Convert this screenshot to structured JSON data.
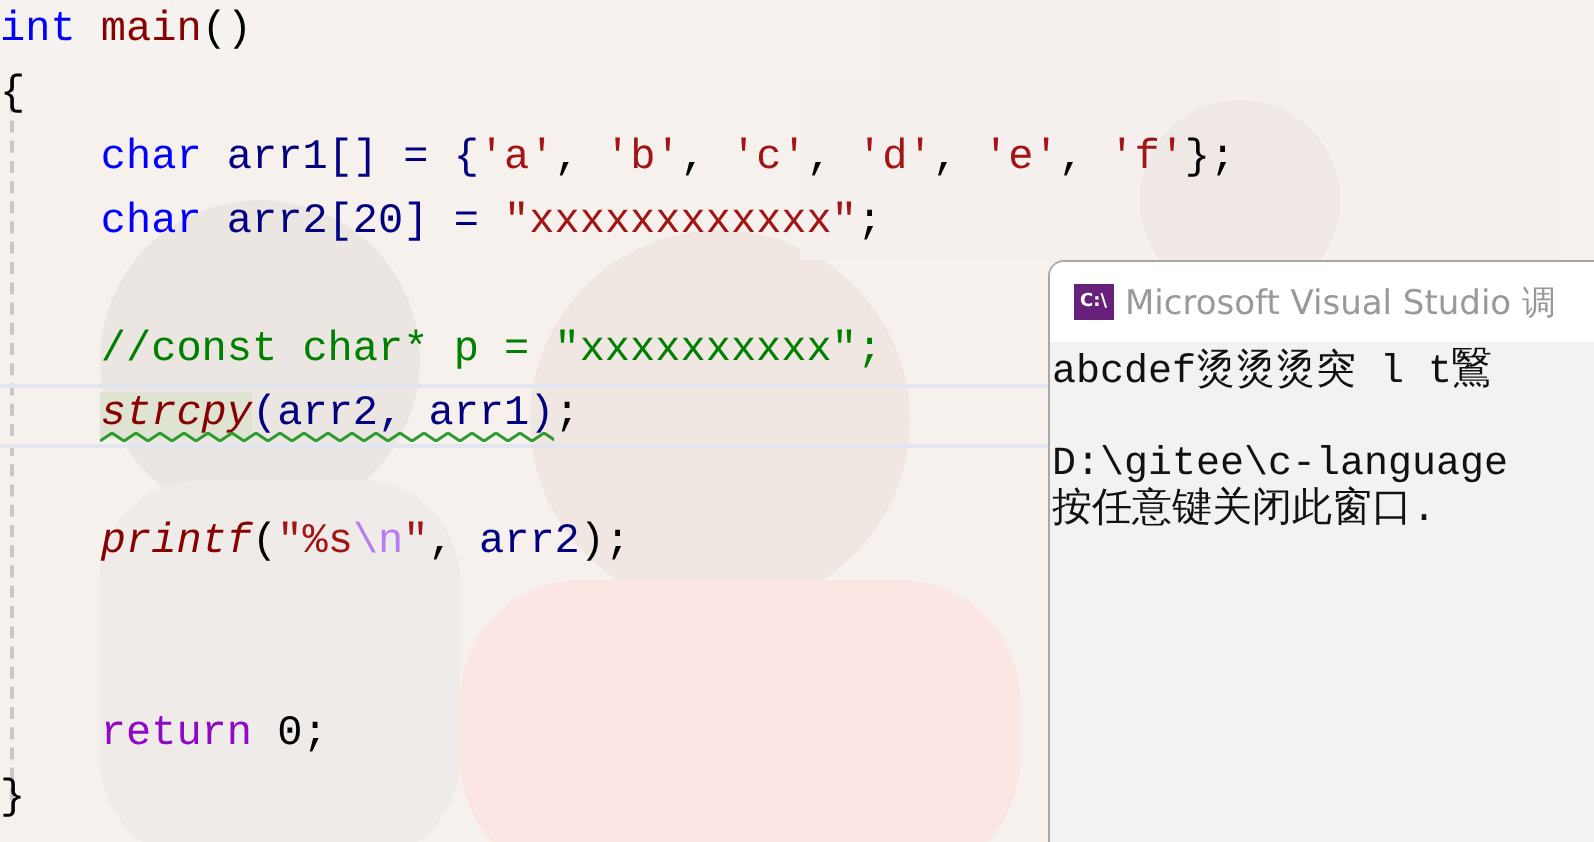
{
  "editor": {
    "lines": [
      {
        "tokens": [
          {
            "text": "int",
            "kind": "keyword"
          },
          {
            "text": " main",
            "kind": "function"
          },
          {
            "text": "()",
            "kind": "punct"
          }
        ]
      },
      {
        "tokens": [
          {
            "text": "{",
            "kind": "punct"
          }
        ]
      },
      {
        "indented": true,
        "tokens": [
          {
            "text": "char",
            "kind": "keyword"
          },
          {
            "text": " arr1[] = {",
            "kind": "ident"
          },
          {
            "text": "'a'",
            "kind": "string"
          },
          {
            "text": ", ",
            "kind": "punct"
          },
          {
            "text": "'b'",
            "kind": "string"
          },
          {
            "text": ", ",
            "kind": "punct"
          },
          {
            "text": "'c'",
            "kind": "string"
          },
          {
            "text": ", ",
            "kind": "punct"
          },
          {
            "text": "'d'",
            "kind": "string"
          },
          {
            "text": ", ",
            "kind": "punct"
          },
          {
            "text": "'e'",
            "kind": "string"
          },
          {
            "text": ", ",
            "kind": "punct"
          },
          {
            "text": "'f'",
            "kind": "string"
          },
          {
            "text": "};",
            "kind": "punct"
          }
        ]
      },
      {
        "indented": true,
        "tokens": [
          {
            "text": "char",
            "kind": "keyword"
          },
          {
            "text": " arr2[20] = ",
            "kind": "ident"
          },
          {
            "text": "\"xxxxxxxxxxxx\"",
            "kind": "string"
          },
          {
            "text": ";",
            "kind": "punct"
          }
        ]
      },
      {
        "kind": "blank"
      },
      {
        "indented": true,
        "tokens": [
          {
            "text": "//const char* p = \"xxxxxxxxxx\";",
            "kind": "comment"
          }
        ]
      },
      {
        "indented": true,
        "current": true,
        "tokens": [
          {
            "text": "strcpy",
            "kind": "call",
            "highlighted": true,
            "squiggle": true
          },
          {
            "text": "(arr2, arr1)",
            "kind": "ident",
            "squiggle": true
          },
          {
            "text": ";",
            "kind": "punct"
          }
        ]
      },
      {
        "kind": "blank"
      },
      {
        "indented": true,
        "tokens": [
          {
            "text": "printf",
            "kind": "call"
          },
          {
            "text": "(",
            "kind": "punct"
          },
          {
            "text": "\"%s",
            "kind": "string"
          },
          {
            "text": "\\n",
            "kind": "escape"
          },
          {
            "text": "\"",
            "kind": "string"
          },
          {
            "text": ", ",
            "kind": "punct"
          },
          {
            "text": "arr2",
            "kind": "ident"
          },
          {
            "text": ");",
            "kind": "punct"
          }
        ]
      },
      {
        "kind": "blank"
      },
      {
        "kind": "blank"
      },
      {
        "indented": true,
        "tokens": [
          {
            "text": "return",
            "kind": "control"
          },
          {
            "text": " 0;",
            "kind": "punct"
          }
        ]
      },
      {
        "tokens": [
          {
            "text": "}",
            "kind": "punct"
          }
        ]
      }
    ]
  },
  "console": {
    "icon_label": "C:\\",
    "title": "Microsoft Visual Studio 调",
    "lines": [
      {
        "kind": "text",
        "text": "abcdef烫烫烫突 l t鷖"
      },
      {
        "kind": "blank"
      },
      {
        "kind": "text",
        "text": "D:\\gitee\\c-language"
      },
      {
        "kind": "text",
        "text": "按任意键关闭此窗口."
      }
    ]
  }
}
